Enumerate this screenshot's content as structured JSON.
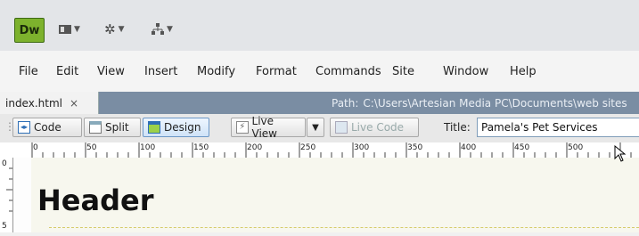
{
  "app": {
    "logo_text": "Dw"
  },
  "top_toolbar": {
    "layout_menu": "layout-icon",
    "settings_menu": "gear-icon",
    "site_menu": "site-icon"
  },
  "menubar": {
    "items": [
      "File",
      "Edit",
      "View",
      "Insert",
      "Modify",
      "Format",
      "Commands",
      "Site",
      "Window",
      "Help"
    ]
  },
  "document": {
    "tab_name": "index.html",
    "tab_close": "×",
    "path_label": "Path:",
    "path_value": "C:\\Users\\Artesian Media PC\\Documents\\web sites"
  },
  "doc_toolbar": {
    "code_label": "Code",
    "split_label": "Split",
    "design_label": "Design",
    "live_view_label": "Live View",
    "live_code_label": "Live Code",
    "title_label": "Title:",
    "title_value": "Pamela's Pet Services"
  },
  "ruler": {
    "ticks": [
      "0",
      "50",
      "100",
      "150",
      "200",
      "250",
      "300",
      "350",
      "400",
      "450",
      "500"
    ],
    "v_ticks": [
      "0",
      "5"
    ]
  },
  "design_view": {
    "heading": "Header"
  },
  "colors": {
    "logo_green": "#7db22d",
    "tab_bar": "#7a8da3",
    "watermark": "#1b8a8a"
  }
}
